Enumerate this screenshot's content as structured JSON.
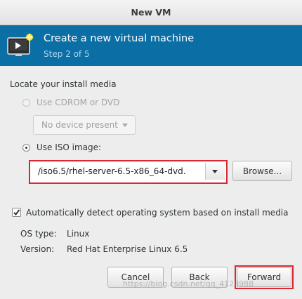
{
  "window": {
    "title": "New VM"
  },
  "header": {
    "title": "Create a new virtual machine",
    "step": "Step 2 of 5",
    "icon": "virtual-machine-monitor-icon"
  },
  "media": {
    "section_label": "Locate your install media",
    "cdrom_option": {
      "label": "Use CDROM or DVD",
      "selected": false,
      "enabled": false
    },
    "device_combo": {
      "value": "No device present",
      "enabled": false
    },
    "iso_option": {
      "label": "Use ISO image:",
      "selected": true
    },
    "iso_path": "/iso6.5/rhel-server-6.5-x86_64-dvd.",
    "browse_label": "Browse..."
  },
  "detect": {
    "label": "Automatically detect operating system based on install media",
    "checked": true
  },
  "os": {
    "type_label": "OS type:",
    "type_value": "Linux",
    "version_label": "Version:",
    "version_value": "Red Hat Enterprise Linux 6.5"
  },
  "buttons": {
    "cancel": "Cancel",
    "back": "Back",
    "forward": "Forward"
  },
  "watermark": "https://blog.csdn.net/qq_4128988",
  "colors": {
    "banner": "#0b6fa6",
    "highlight": "#d9282f"
  }
}
